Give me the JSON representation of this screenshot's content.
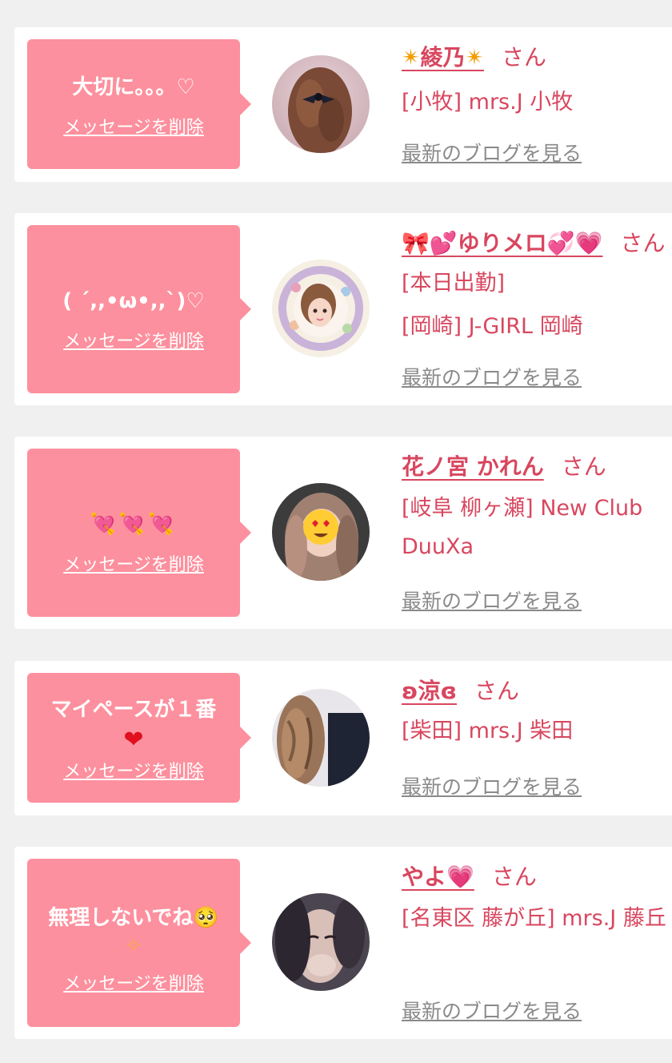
{
  "delete_label": "メッセージを削除",
  "blog_label": "最新のブログを見る",
  "san_label": "さん",
  "cards": [
    {
      "message": "大切に。。。♡",
      "name": "綾乃",
      "name_prefix": "✴",
      "name_suffix": "✴",
      "details": [
        "[小牧] mrs.J 小牧"
      ]
    },
    {
      "message": "( ´,,•ω•,,`)♡",
      "name": "ゆりメロ",
      "name_prefix": "🎀💕",
      "name_suffix": "💞💗",
      "details": [
        "[本日出勤]",
        "[岡崎] J-GIRL 岡崎"
      ]
    },
    {
      "message": "💘💘💘",
      "name": "花ノ宮 かれん",
      "details": [
        "[岐阜 柳ヶ瀬] New Club DuuXa"
      ]
    },
    {
      "message": "マイペースが１番",
      "message_extra": "❤",
      "name": "ʚ涼ɞ",
      "details": [
        "[柴田] mrs.J 柴田"
      ]
    },
    {
      "message": "無理しないでね🥺",
      "message_extra": "✧",
      "name": "やよ",
      "name_suffix": "💗",
      "details": [
        "[名東区 藤が丘] mrs.J 藤丘"
      ]
    }
  ],
  "colors": {
    "page_bg": "#f0f0f0",
    "bubble": "#fd909e",
    "accent_text": "#d8475f",
    "link_gray": "#8a8a8a"
  }
}
